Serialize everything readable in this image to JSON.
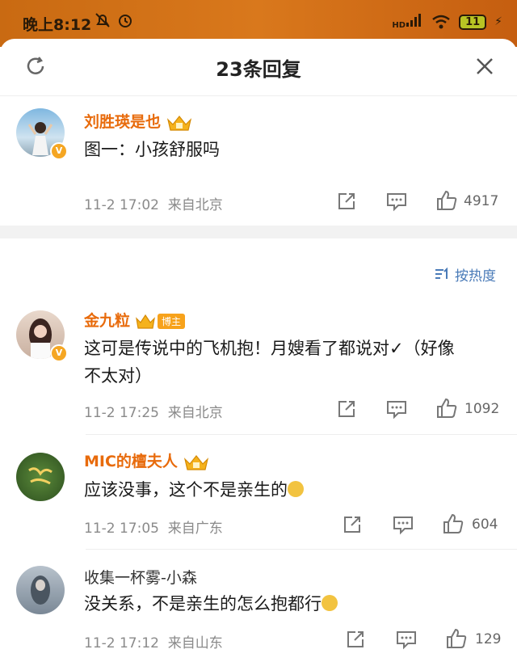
{
  "status_bar": {
    "time": "晚上8:12",
    "battery": "11",
    "network": "HD"
  },
  "header": {
    "title": "23条回复"
  },
  "sort": {
    "label": "按热度"
  },
  "main_comment": {
    "username": "刘胜瑛是也",
    "text": "图一：小孩舒服吗",
    "time": "11-2 17:02",
    "location": "来自北京",
    "likes": "4917"
  },
  "replies": [
    {
      "username": "金九粒",
      "badge": "博主",
      "text_line1": "这可是传说中的飞机抱！月嫂看了都说对✓（好像",
      "text_line2": "不太对）",
      "time": "11-2 17:25",
      "location": "来自北京",
      "likes": "1092"
    },
    {
      "username": "MIC的檀夫人",
      "text": "应该没事，这个不是亲生的",
      "time": "11-2 17:05",
      "location": "来自广东",
      "likes": "604"
    },
    {
      "username": "收集一杯雾-小森",
      "text": "没关系，不是亲生的怎么抱都行",
      "time": "11-2 17:12",
      "location": "来自山东",
      "likes": "129"
    }
  ]
}
